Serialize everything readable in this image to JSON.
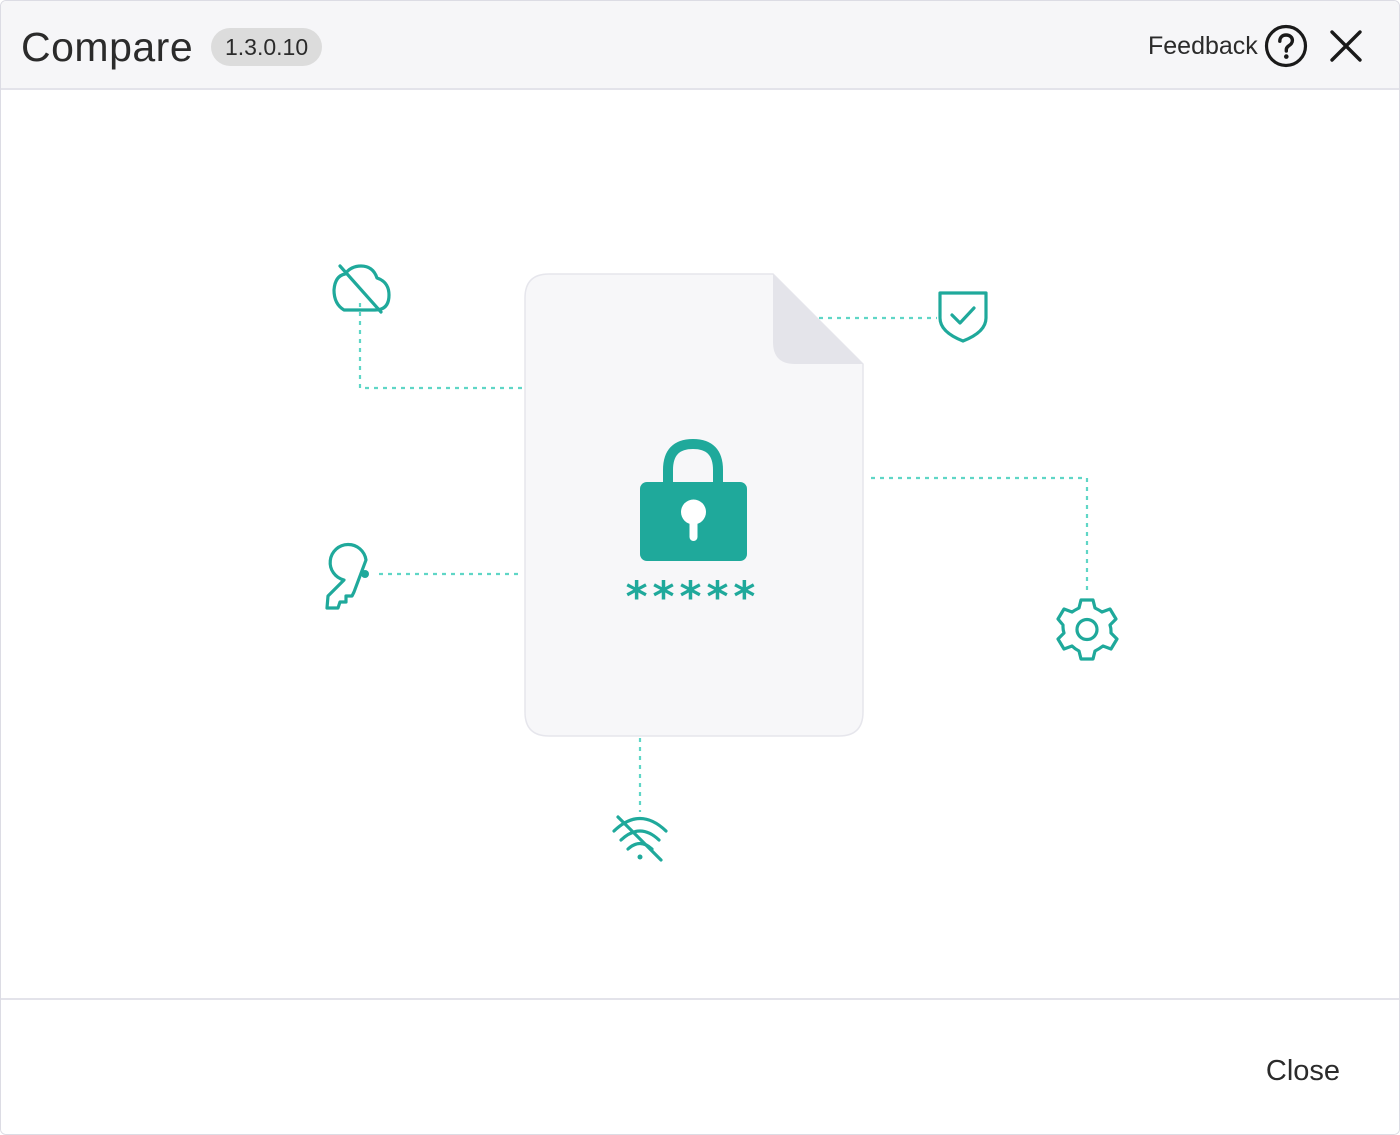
{
  "window": {
    "title": "Compare",
    "version": "1.3.0.10"
  },
  "header": {
    "feedback_label": "Feedback",
    "help_icon": "question-circle-icon",
    "close_icon": "close-icon"
  },
  "illustration": {
    "asterisks": "*****",
    "icons": [
      "cloud-off-icon",
      "shield-check-icon",
      "key-icon",
      "settings-gear-icon",
      "wifi-off-icon",
      "padlock-icon",
      "document-icon"
    ],
    "colors": {
      "accent": "#1fa99b",
      "connector": "#5fd6c6",
      "document": "#f7f7f9",
      "document_fold": "#e4e4ea"
    }
  },
  "footer": {
    "close_label": "Close"
  }
}
